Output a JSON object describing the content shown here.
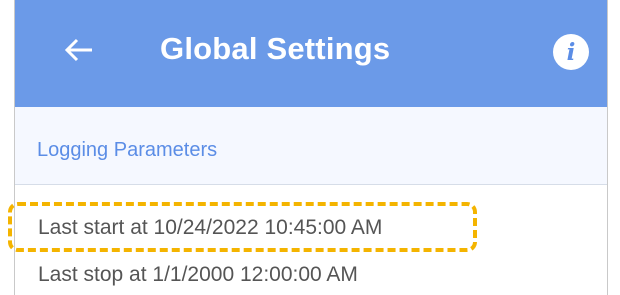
{
  "header": {
    "title": "Global Settings",
    "back_icon": "arrow-left-icon",
    "info_icon": "info-icon",
    "info_glyph": "i",
    "bar_color": "#6b9ae8"
  },
  "section": {
    "label": "Logging Parameters",
    "accent_color": "#5b8de6"
  },
  "rows": [
    {
      "text": "Last start at 10/24/2022 10:45:00 AM",
      "highlighted": true
    },
    {
      "text": "Last stop at 1/1/2000 12:00:00 AM",
      "highlighted": false
    }
  ],
  "highlight": {
    "color": "#f4b400",
    "style": "dashed"
  }
}
